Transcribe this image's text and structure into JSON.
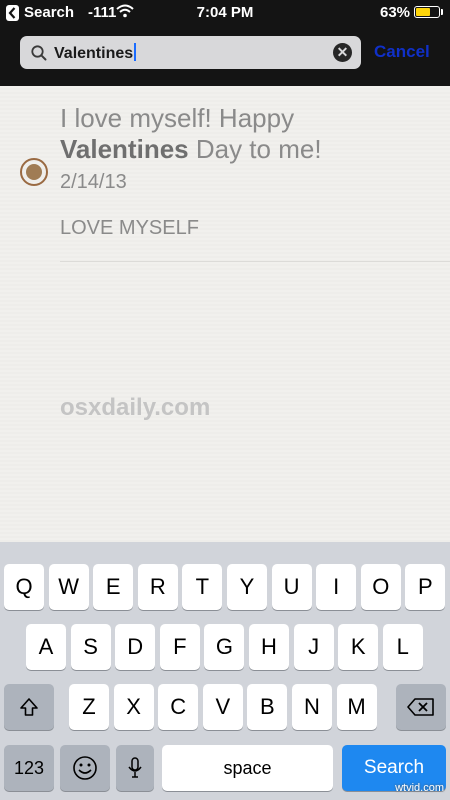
{
  "status_bar": {
    "back_label": "Search",
    "signal": "-111",
    "time": "7:04 PM",
    "battery_pct": "63%",
    "battery_level": 0.63
  },
  "search": {
    "query": "Valentines",
    "cancel_label": "Cancel",
    "clear_icon": "clear-x-icon"
  },
  "result": {
    "title_prefix": "I love myself! Happy ",
    "title_highlight": "Valentines",
    "title_suffix": " Day to me!",
    "date": "2/14/13",
    "tag": "LOVE MYSELF"
  },
  "watermark": "osxdaily.com",
  "keyboard": {
    "row1": [
      "Q",
      "W",
      "E",
      "R",
      "T",
      "Y",
      "U",
      "I",
      "O",
      "P"
    ],
    "row2": [
      "A",
      "S",
      "D",
      "F",
      "G",
      "H",
      "J",
      "K",
      "L"
    ],
    "row3": [
      "Z",
      "X",
      "C",
      "V",
      "B",
      "N",
      "M"
    ],
    "numbers_label": "123",
    "space_label": "space",
    "search_label": "Search"
  },
  "corner_watermark": "wtvid.com",
  "colors": {
    "accent": "#1e88f0",
    "cancel": "#1030c8",
    "radio": "#a07c54",
    "battery": "#ffd60a"
  }
}
